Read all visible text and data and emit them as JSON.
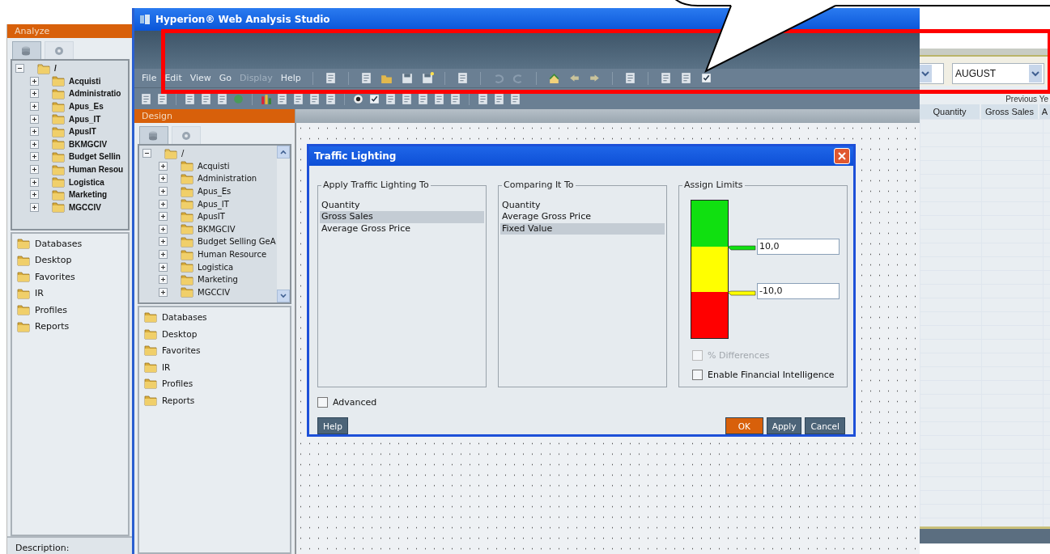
{
  "back_window": {
    "panel_title": "Analyze",
    "tabs": [
      {
        "selected": true
      },
      {
        "selected": false
      }
    ],
    "tree": {
      "label": "/",
      "expanded": true,
      "children": [
        {
          "label": "Acquisti",
          "expanded": false
        },
        {
          "label": "Administratio",
          "expanded": false
        },
        {
          "label": "Apus_Es",
          "expanded": false
        },
        {
          "label": "Apus_IT",
          "expanded": false
        },
        {
          "label": "ApusIT",
          "expanded": false
        },
        {
          "label": "BKMGCIV",
          "expanded": false
        },
        {
          "label": "Budget Sellin",
          "expanded": false
        },
        {
          "label": "Human Resou",
          "expanded": false
        },
        {
          "label": "Logistica",
          "expanded": false
        },
        {
          "label": "Marketing",
          "expanded": false
        },
        {
          "label": "MGCCIV",
          "expanded": false
        }
      ]
    },
    "places": [
      "Databases",
      "Desktop",
      "Favorites",
      "IR",
      "Profiles",
      "Reports"
    ],
    "description_label": "Description:"
  },
  "main_window": {
    "title": "Hyperion® Web Analysis Studio",
    "menu": [
      {
        "label": "File",
        "disabled": false
      },
      {
        "label": "Edit",
        "disabled": false
      },
      {
        "label": "View",
        "disabled": false
      },
      {
        "label": "Go",
        "disabled": false
      },
      {
        "label": "Display",
        "disabled": true
      },
      {
        "label": "Help",
        "disabled": false
      }
    ],
    "design_panel": {
      "title": "Design",
      "tabs": [
        {
          "selected": true
        },
        {
          "selected": false
        }
      ],
      "tree": {
        "label": "/",
        "expanded": true,
        "children": [
          {
            "label": "Acquisti",
            "expanded": false
          },
          {
            "label": "Administration",
            "expanded": false
          },
          {
            "label": "Apus_Es",
            "expanded": false
          },
          {
            "label": "Apus_IT",
            "expanded": false
          },
          {
            "label": "ApusIT",
            "expanded": false
          },
          {
            "label": "BKMGCIV",
            "expanded": false
          },
          {
            "label": "Budget Selling GeA",
            "expanded": false
          },
          {
            "label": "Human Resource",
            "expanded": false
          },
          {
            "label": "Logistica",
            "expanded": false
          },
          {
            "label": "Marketing",
            "expanded": false
          },
          {
            "label": "MGCCIV",
            "expanded": false
          }
        ]
      },
      "places": [
        "Databases",
        "Desktop",
        "Favorites",
        "IR",
        "Profiles",
        "Reports"
      ]
    }
  },
  "dialog": {
    "title": "Traffic Lighting",
    "apply_group": {
      "title": "Apply Traffic Lighting To",
      "items": [
        {
          "label": "Quantity",
          "selected": false
        },
        {
          "label": "Gross Sales",
          "selected": true
        },
        {
          "label": "Average Gross Price",
          "selected": false
        }
      ]
    },
    "compare_group": {
      "title": "Comparing It To",
      "items": [
        {
          "label": "Quantity",
          "selected": false
        },
        {
          "label": "Average Gross Price",
          "selected": false
        },
        {
          "label": "Fixed Value",
          "selected": true
        }
      ]
    },
    "limits_group": {
      "title": "Assign Limits",
      "upper_limit": "10,0",
      "lower_limit": "-10,0",
      "options": [
        {
          "label": "% Differences",
          "checked": false,
          "disabled": true
        },
        {
          "label": "Enable Financial Intelligence",
          "checked": false,
          "disabled": false
        }
      ]
    },
    "advanced": {
      "label": "Advanced",
      "checked": false
    },
    "buttons": [
      {
        "label": "Help",
        "kind": "normal"
      },
      {
        "label": "OK",
        "kind": "primary"
      },
      {
        "label": "Apply",
        "kind": "normal"
      },
      {
        "label": "Cancel",
        "kind": "normal"
      }
    ]
  },
  "report_window": {
    "month_combo": "AUGUST",
    "group_header": "Previous Ye",
    "columns": [
      "Quantity",
      "Gross Sales",
      "A"
    ]
  }
}
